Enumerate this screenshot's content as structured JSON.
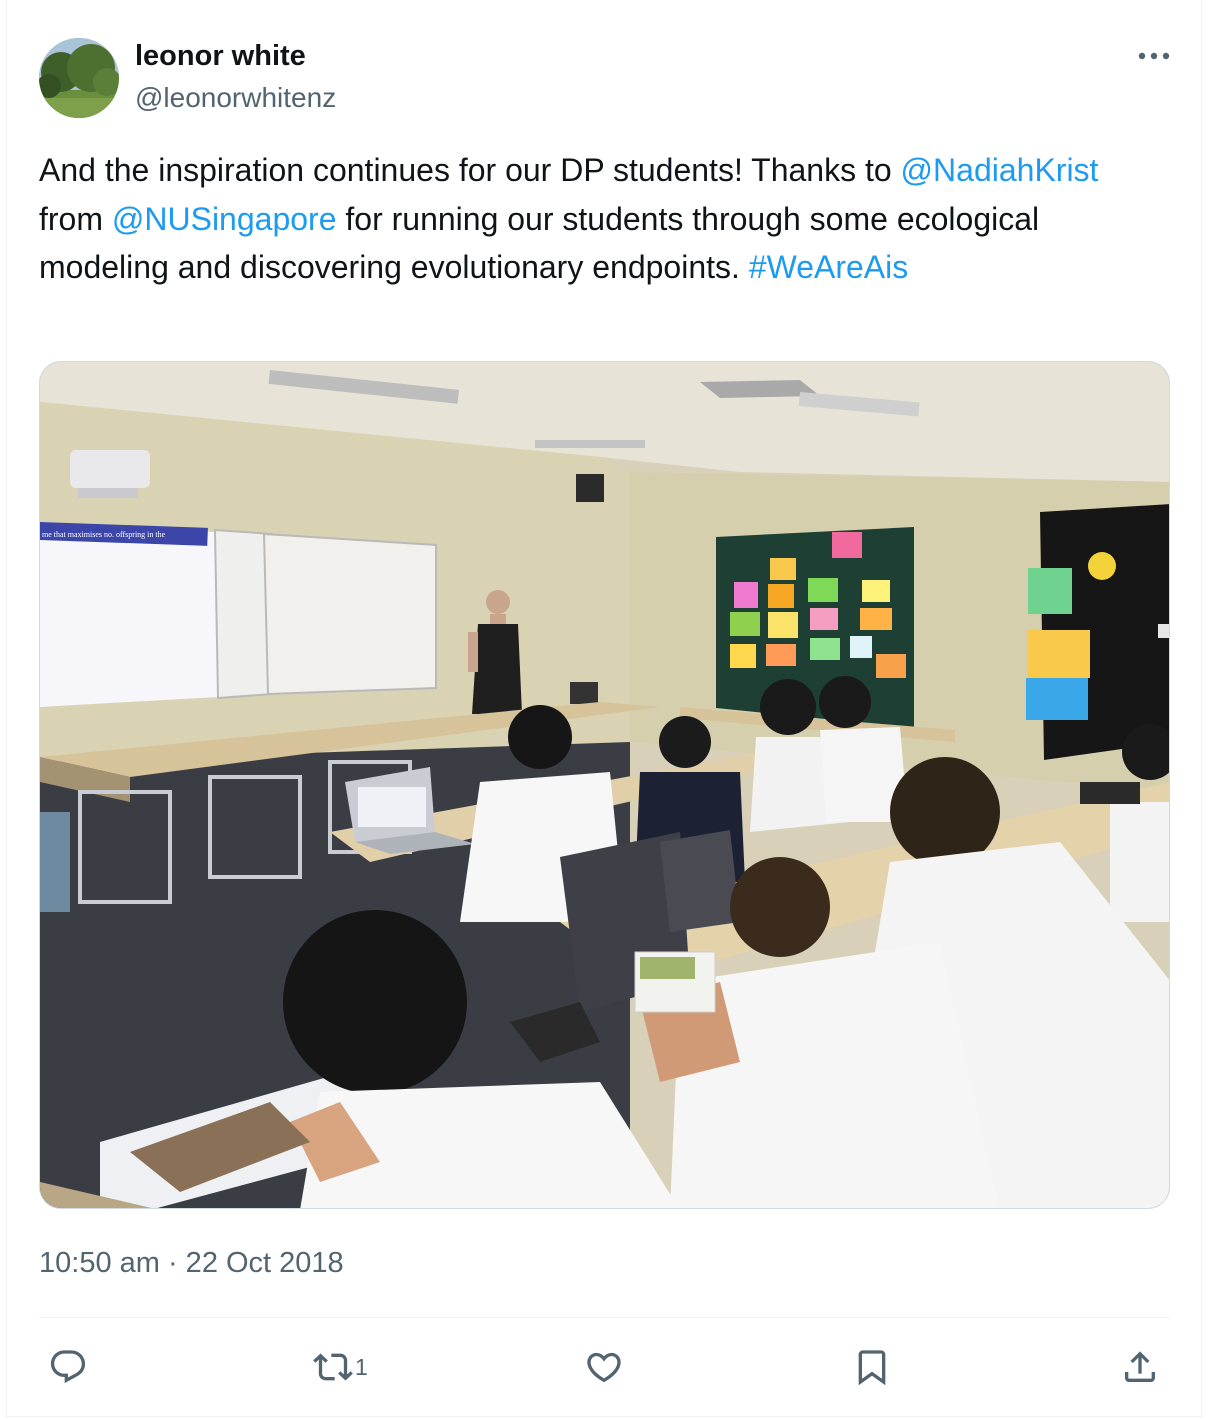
{
  "author": {
    "display_name": "leonor white",
    "handle": "@leonorwhitenz"
  },
  "tweet": {
    "text_parts": [
      "And the inspiration continues for our DP students! Thanks to ",
      "@NadiahKrist",
      " from ",
      "@NUSingapore",
      " for running our students through some ecological modeling and discovering evolutionary endpoints. ",
      "#WeAreAis"
    ],
    "media_slide_text": "me that maximises no. offspring in the",
    "timestamp": "10:50 am · 22 Oct 2018"
  },
  "actions": {
    "reply_icon": "reply-icon",
    "retweet_icon": "retweet-icon",
    "retweet_count": "1",
    "like_icon": "heart-icon",
    "bookmark_icon": "bookmark-icon",
    "share_icon": "share-icon"
  },
  "colors": {
    "link": "#1d9bf0",
    "text": "#0f1419",
    "secondary": "#536471"
  }
}
